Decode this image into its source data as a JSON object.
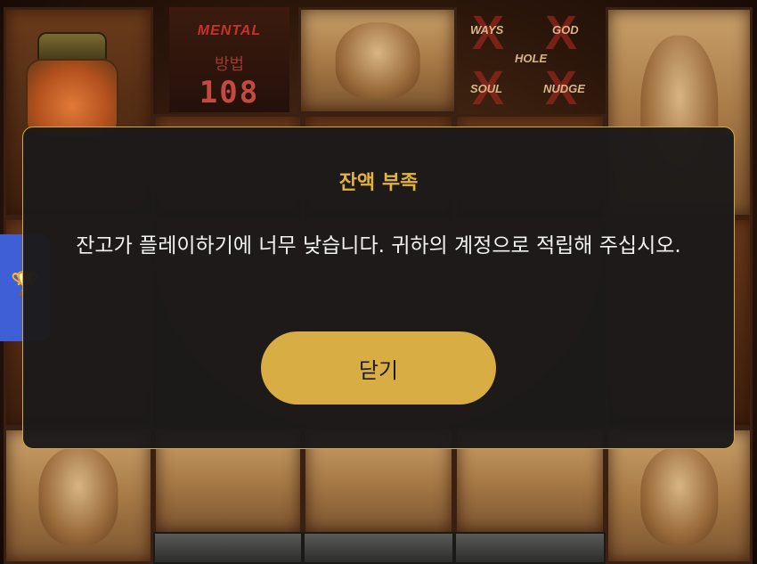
{
  "game": {
    "mental_title": "MENTAL",
    "method_label": "방법",
    "method_count": "108",
    "modes": [
      "WAYS",
      "GOD",
      "HOLE",
      "SOUL",
      "NUDGE"
    ]
  },
  "dialog": {
    "title": "잔액 부족",
    "message": "잔고가 플레이하기에 너무 낮습니다. 귀하의 계정으로 적립해 주십시오.",
    "close_label": "닫기"
  },
  "colors": {
    "accent": "#d8ad44",
    "title": "#e2b43f",
    "dialog_bg": "#1c1a1a",
    "side_tab": "#3f5fd6"
  },
  "icons": {
    "side_tab": "trophy-icon"
  }
}
